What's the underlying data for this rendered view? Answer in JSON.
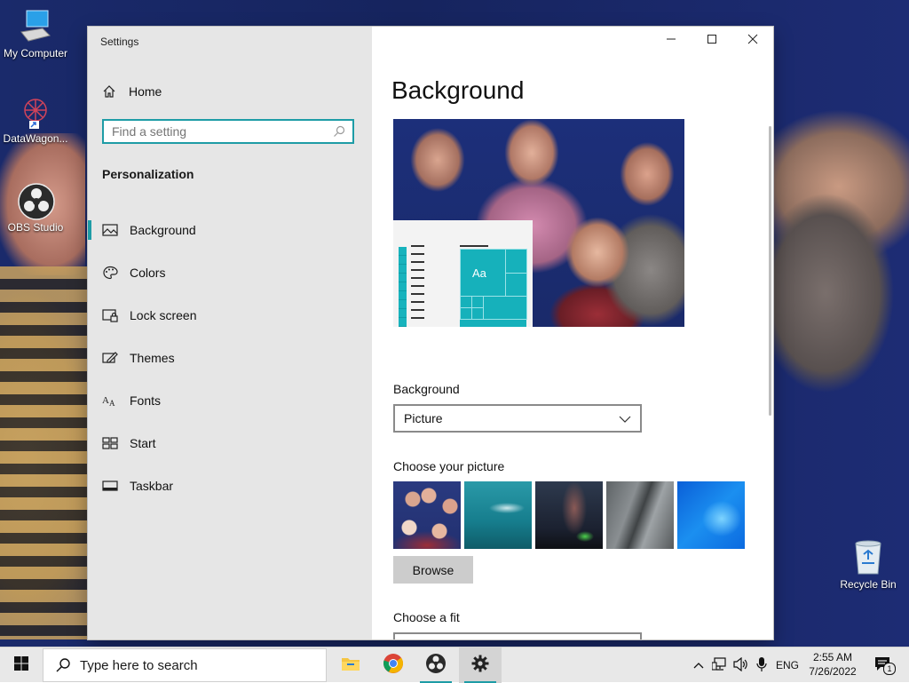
{
  "desktop": {
    "icons": [
      {
        "label": "My Computer"
      },
      {
        "label": "DataWagon..."
      },
      {
        "label": "OBS Studio"
      }
    ],
    "recycle_bin": "Recycle Bin"
  },
  "window": {
    "title": "Settings",
    "nav": {
      "home": "Home",
      "search_placeholder": "Find a setting",
      "section": "Personalization",
      "items": [
        {
          "label": "Background",
          "icon": "picture-icon",
          "active": true
        },
        {
          "label": "Colors",
          "icon": "palette-icon"
        },
        {
          "label": "Lock screen",
          "icon": "lock-screen-icon"
        },
        {
          "label": "Themes",
          "icon": "themes-icon"
        },
        {
          "label": "Fonts",
          "icon": "fonts-icon"
        },
        {
          "label": "Start",
          "icon": "start-icon"
        },
        {
          "label": "Taskbar",
          "icon": "taskbar-icon"
        }
      ]
    },
    "content": {
      "title": "Background",
      "preview_sample_text": "Aa",
      "background_label": "Background",
      "background_value": "Picture",
      "choose_picture_label": "Choose your picture",
      "browse_label": "Browse",
      "choose_fit_label": "Choose a fit"
    },
    "accent_color": "#1e9ca6"
  },
  "taskbar": {
    "search_placeholder": "Type here to search",
    "apps": [
      "file-explorer-icon",
      "chrome-icon",
      "obs-icon",
      "settings-icon"
    ],
    "language": "ENG",
    "time": "2:55 AM",
    "date": "7/26/2022",
    "notification_count": "1"
  }
}
